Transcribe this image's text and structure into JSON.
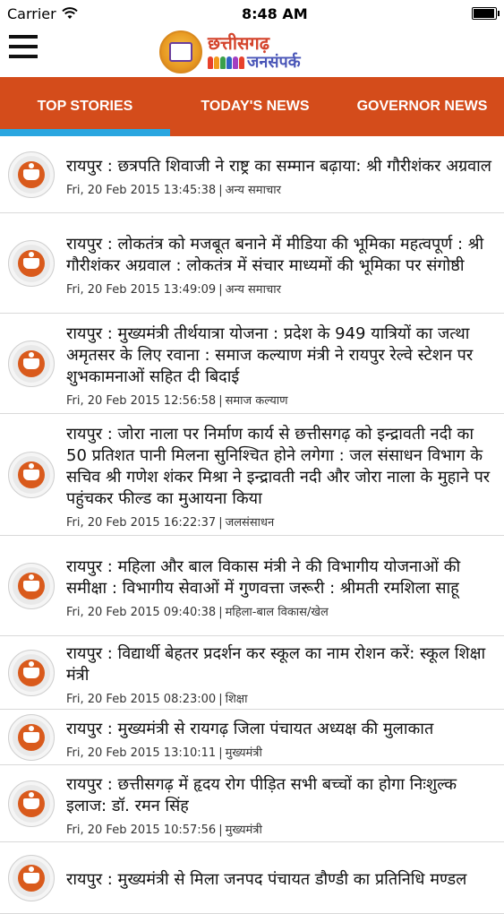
{
  "status_bar": {
    "carrier": "Carrier",
    "time": "8:48 AM"
  },
  "header": {
    "logo_line1": "छत्तीसगढ़",
    "logo_line2": "जनसंपर्क"
  },
  "tabs": [
    {
      "label": "TOP STORIES"
    },
    {
      "label": "TODAY'S NEWS"
    },
    {
      "label": "GOVERNOR NEWS"
    }
  ],
  "news": [
    {
      "title": "    रायपुर  : छत्रपति शिवाजी ने राष्ट्र का सम्मान बढ़ाया: श्री गौरीशंकर अग्रवाल",
      "date": "Fri, 20 Feb 2015 13:45:38",
      "category": "अन्य समाचार"
    },
    {
      "title": "    रायपुर  :  लोकतंत्र को मजबूत बनाने में मीडिया की भूमिका महत्वपूर्ण : श्री गौरीशंकर अग्रवाल : लोकतंत्र में संचार माध्यमों की भूमिका पर संगोष्ठी",
      "date": "Fri, 20 Feb 2015 13:49:09",
      "category": "अन्य समाचार"
    },
    {
      "title": "रायपुर : मुख्यमंत्री तीर्थयात्रा योजना : प्रदेश के 949 यात्रियों का जत्था अमृतसर के लिए रवाना : समाज कल्याण मंत्री ने रायपुर रेल्वे स्टेशन पर शुभकामनाओं सहित दी बिदाई",
      "date": "Fri, 20 Feb 2015 12:56:58",
      "category": "समाज कल्याण"
    },
    {
      "title": "रायपुर :  जोरा नाला पर निर्माण कार्य से छत्तीसगढ़ को इन्द्रावती नदी का 50 प्रतिशत पानी मिलना सुनिश्चित होने लगेगा : जल संसाधन विभाग के सचिव श्री गणेश शंकर मिश्रा ने इन्द्रावती नदी और जोरा नाला के मुहाने पर पहुंचकर फील्ड का मुआयना किया",
      "date": "Fri, 20 Feb 2015 16:22:37",
      "category": "जलसंसाधन"
    },
    {
      "title": "रायपुर   : महिला और बाल विकास मंत्री ने की विभागीय योजनाओं की समीक्षा :  विभागीय सेवाओं में गुणवत्ता जरूरी : श्रीमती रमशिला साहू",
      "date": "Fri, 20 Feb 2015 09:40:38",
      "category": "महिला-बाल विकास/खेल"
    },
    {
      "title": "रायपुर : विद्यार्थी बेहतर प्रदर्शन कर स्कूल का नाम रोशन करें: स्कूल शिक्षा मंत्री",
      "date": "Fri, 20 Feb 2015 08:23:00",
      "category": "शिक्षा"
    },
    {
      "title": "रायपुर  : मुख्यमंत्री से रायगढ़ जिला पंचायत अध्यक्ष की मुलाकात",
      "date": "Fri, 20 Feb 2015 13:10:11",
      "category": "मुख्यमंत्री"
    },
    {
      "title": "रायपुर  : छत्तीसगढ़ में हृदय रोग पीड़ित सभी बच्चों का होगा निःशुल्क इलाज: डॉ. रमन सिंह",
      "date": "Fri, 20 Feb 2015 10:57:56",
      "category": "मुख्यमंत्री"
    },
    {
      "title": "रायपुर : मुख्यमंत्री से मिला जनपद पंचायत डौण्डी का प्रतिनिधि मण्डल",
      "date": "",
      "category": ""
    }
  ]
}
